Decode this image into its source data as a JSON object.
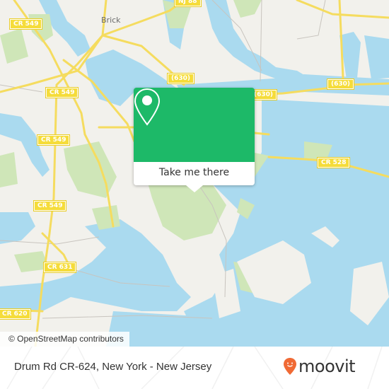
{
  "map": {
    "place_labels": [
      {
        "name": "place-brick",
        "text": "Brick"
      }
    ],
    "road_labels": [
      {
        "text": "CR 549"
      },
      {
        "text": "CR 549"
      },
      {
        "text": "CR 549"
      },
      {
        "text": "CR 549"
      },
      {
        "text": "CR 549"
      },
      {
        "text": "CR 631"
      },
      {
        "text": "CR 620"
      },
      {
        "text": "(630)"
      },
      {
        "text": "(630)"
      },
      {
        "text": "(630)"
      },
      {
        "text": "CR 528"
      },
      {
        "text": "NJ 88"
      }
    ],
    "attribution": "© OpenStreetMap contributors",
    "colors": {
      "land": "#f2f1ec",
      "water": "#aadaef",
      "park": "#cfe6b8",
      "road": "#f5dc5f"
    }
  },
  "popup": {
    "action_label": "Take me there",
    "icon": "map-pin-icon",
    "color": "#1db968"
  },
  "footer": {
    "title": "Drum Rd CR-624, New York - New Jersey",
    "brand": "moovit",
    "brand_color": "#f06a35"
  }
}
